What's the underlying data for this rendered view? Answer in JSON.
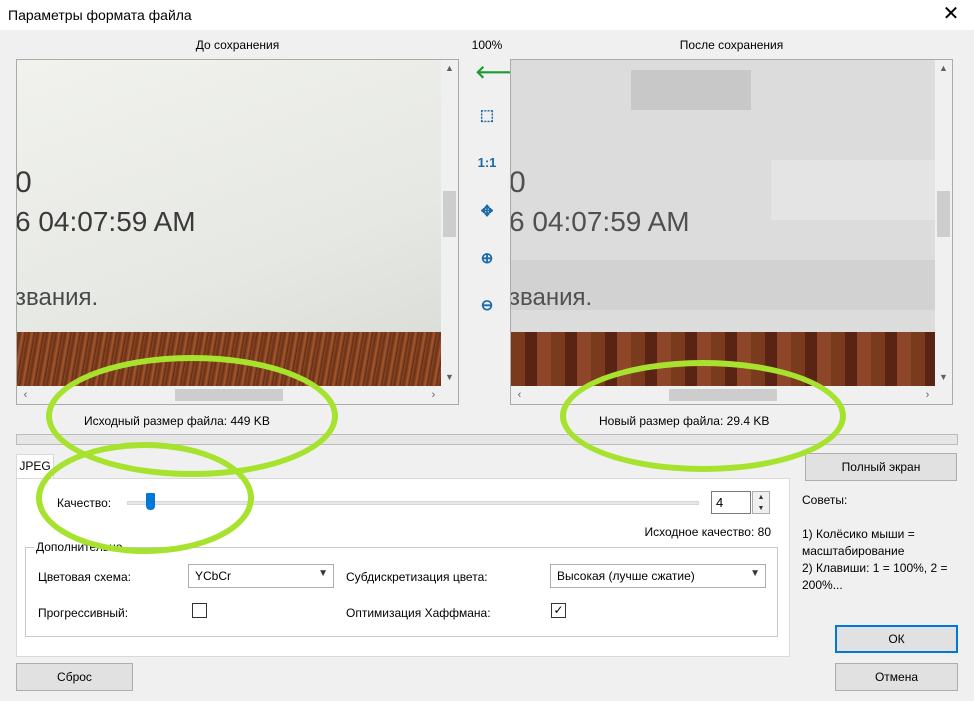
{
  "window": {
    "title": "Параметры формата файла",
    "close_symbol": "✕"
  },
  "preview": {
    "before_label": "До сохранения",
    "after_label": "После сохранения",
    "zoom_level": "100%",
    "image_text": {
      "line1": "0",
      "line2": "6 04:07:59 AM",
      "line3": "звания."
    }
  },
  "tools": {
    "back_icon": "🡐",
    "fit_icon": "⬚",
    "actual_size": "1:1",
    "center_icon": "✥",
    "zoom_in_icon": "⊕",
    "zoom_out_icon": "⊖"
  },
  "sizes": {
    "original_label": "Исходный размер файла:",
    "original_value": "449 KB",
    "new_label": "Новый размер файла:",
    "new_value": "29.4 KB"
  },
  "jpeg_tab": {
    "tab_label": "JPEG",
    "quality_label": "Качество:",
    "quality_value": "4",
    "quality_fraction": 0.04,
    "original_quality_label": "Исходное качество:",
    "original_quality_value": "80",
    "group_title": "Дополнительно",
    "color_scheme_label": "Цветовая схема:",
    "color_scheme_value": "YCbCr",
    "subsampling_label": "Субдискретизация цвета:",
    "subsampling_value": "Высокая (лучше сжатие)",
    "progressive_label": "Прогрессивный:",
    "progressive_checked": false,
    "huffman_label": "Оптимизация Хаффмана:",
    "huffman_checked": true
  },
  "side": {
    "fullscreen_label": "Полный экран",
    "tips_title": "Советы:",
    "tip1": "1) Колёсико мыши = масштабирование",
    "tip2": "2) Клавиши: 1 = 100%, 2 = 200%..."
  },
  "buttons": {
    "reset": "Сброс",
    "ok": "ОК",
    "cancel": "Отмена"
  },
  "colors": {
    "annotation": "#a6e22e",
    "accent": "#0078d7"
  }
}
